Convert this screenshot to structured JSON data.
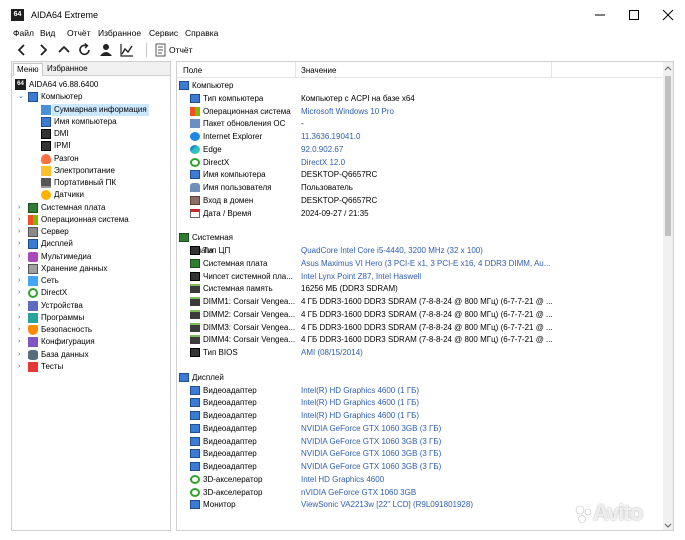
{
  "window": {
    "title": "AIDA64 Extreme",
    "icon_text": "64"
  },
  "menu": [
    "Файл",
    "Вид",
    "Отчёт",
    "Избранное",
    "Сервис",
    "Справка"
  ],
  "toolbar": {
    "report_label": "Отчёт"
  },
  "left_tabs": [
    "Меню",
    "Избранное"
  ],
  "tree": {
    "root_label": "AIDA64 v6.88.6400",
    "computer_label": "Компьютер",
    "computer_children": [
      {
        "label": "Суммарная информация",
        "icon": "info-icon"
      },
      {
        "label": "Имя компьютера",
        "icon": "computer-icon"
      },
      {
        "label": "DMI",
        "icon": "chip-icon"
      },
      {
        "label": "IPMI",
        "icon": "chip-icon"
      },
      {
        "label": "Разгон",
        "icon": "fire-icon"
      },
      {
        "label": "Электропитание",
        "icon": "power-icon"
      },
      {
        "label": "Портативный ПК",
        "icon": "laptop-icon"
      },
      {
        "label": "Датчики",
        "icon": "gauge-icon"
      }
    ],
    "top_items": [
      {
        "label": "Системная плата",
        "icon": "motherboard-icon"
      },
      {
        "label": "Операционная система",
        "icon": "windows-icon"
      },
      {
        "label": "Сервер",
        "icon": "server-icon"
      },
      {
        "label": "Дисплей",
        "icon": "monitor-icon"
      },
      {
        "label": "Мультимедиа",
        "icon": "multimedia-icon"
      },
      {
        "label": "Хранение данных",
        "icon": "storage-icon"
      },
      {
        "label": "Сеть",
        "icon": "network-icon"
      },
      {
        "label": "DirectX",
        "icon": "directx-icon"
      },
      {
        "label": "Устройства",
        "icon": "devices-icon"
      },
      {
        "label": "Программы",
        "icon": "programs-icon"
      },
      {
        "label": "Безопасность",
        "icon": "security-icon"
      },
      {
        "label": "Конфигурация",
        "icon": "config-icon"
      },
      {
        "label": "База данных",
        "icon": "database-icon"
      },
      {
        "label": "Тесты",
        "icon": "tests-icon"
      }
    ]
  },
  "columns": {
    "field": "Поле",
    "value": "Значение"
  },
  "sections": [
    {
      "title": "Компьютер",
      "icon": "computer-icon",
      "rows": [
        {
          "field": "Тип компьютера",
          "value": "Компьютер с ACPI на базе x64",
          "link": false,
          "icon": "computer-icon"
        },
        {
          "field": "Операционная система",
          "value": "Microsoft Windows 10 Pro",
          "link": true,
          "icon": "windows-icon"
        },
        {
          "field": "Пакет обновления ОС",
          "value": "-",
          "link": false,
          "icon": "package-icon"
        },
        {
          "field": "Internet Explorer",
          "value": "11.3636.19041.0",
          "link": true,
          "icon": "ie-icon"
        },
        {
          "field": "Edge",
          "value": "92.0.902.67",
          "link": true,
          "icon": "edge-icon"
        },
        {
          "field": "DirectX",
          "value": "DirectX 12.0",
          "link": true,
          "icon": "directx-icon"
        },
        {
          "field": "Имя компьютера",
          "value": "DESKTOP-Q6657RC",
          "link": false,
          "icon": "computer-icon"
        },
        {
          "field": "Имя пользователя",
          "value": "Пользователь",
          "link": false,
          "icon": "user-icon"
        },
        {
          "field": "Вход в домен",
          "value": "DESKTOP-Q6657RC",
          "link": false,
          "icon": "domain-icon"
        },
        {
          "field": "Дата / Время",
          "value": "2024-09-27 / 21:35",
          "link": false,
          "icon": "calendar-icon"
        }
      ]
    },
    {
      "title": "Системная плата",
      "icon": "motherboard-icon",
      "rows": [
        {
          "field": "Тип ЦП",
          "value": "QuadCore Intel Core i5-4440, 3200 MHz (32 x 100)",
          "link": true,
          "icon": "cpu-icon"
        },
        {
          "field": "Системная плата",
          "value": "Asus Maximus VI Hero  (3 PCI-E x1, 3 PCI-E x16, 4 DDR3 DIMM, Au...",
          "link": true,
          "icon": "motherboard-icon"
        },
        {
          "field": "Чипсет системной пла...",
          "value": "Intel Lynx Point Z87, Intel Haswell",
          "link": true,
          "icon": "chip-icon"
        },
        {
          "field": "Системная память",
          "value": "16256 МБ  (DDR3 SDRAM)",
          "link": false,
          "icon": "ram-icon"
        },
        {
          "field": "DIMM1: Corsair Vengea...",
          "value": "4 ГБ DDR3-1600 DDR3 SDRAM  (7-8-8-24 @ 800 МГц)  (6-7-7-21 @ ...",
          "link": false,
          "icon": "ram-icon"
        },
        {
          "field": "DIMM2: Corsair Vengea...",
          "value": "4 ГБ DDR3-1600 DDR3 SDRAM  (7-8-8-24 @ 800 МГц)  (6-7-7-21 @ ...",
          "link": false,
          "icon": "ram-icon"
        },
        {
          "field": "DIMM3: Corsair Vengea...",
          "value": "4 ГБ DDR3-1600 DDR3 SDRAM  (7-8-8-24 @ 800 МГц)  (6-7-7-21 @ ...",
          "link": false,
          "icon": "ram-icon"
        },
        {
          "field": "DIMM4: Corsair Vengea...",
          "value": "4 ГБ DDR3-1600 DDR3 SDRAM  (7-8-8-24 @ 800 МГц)  (6-7-7-21 @ ...",
          "link": false,
          "icon": "ram-icon"
        },
        {
          "field": "Тип BIOS",
          "value": "AMI (08/15/2014)",
          "link": true,
          "icon": "chip-icon"
        }
      ]
    },
    {
      "title": "Дисплей",
      "icon": "monitor-icon",
      "rows": [
        {
          "field": "Видеоадаптер",
          "value": "Intel(R) HD Graphics 4600  (1 ГБ)",
          "link": true,
          "icon": "monitor-icon"
        },
        {
          "field": "Видеоадаптер",
          "value": "Intel(R) HD Graphics 4600  (1 ГБ)",
          "link": true,
          "icon": "monitor-icon"
        },
        {
          "field": "Видеоадаптер",
          "value": "Intel(R) HD Graphics 4600  (1 ГБ)",
          "link": true,
          "icon": "monitor-icon"
        },
        {
          "field": "Видеоадаптер",
          "value": "NVIDIA GeForce GTX 1060 3GB  (3 ГБ)",
          "link": true,
          "icon": "monitor-icon"
        },
        {
          "field": "Видеоадаптер",
          "value": "NVIDIA GeForce GTX 1060 3GB  (3 ГБ)",
          "link": true,
          "icon": "monitor-icon"
        },
        {
          "field": "Видеоадаптер",
          "value": "NVIDIA GeForce GTX 1060 3GB  (3 ГБ)",
          "link": true,
          "icon": "monitor-icon"
        },
        {
          "field": "Видеоадаптер",
          "value": "NVIDIA GeForce GTX 1060 3GB  (3 ГБ)",
          "link": true,
          "icon": "monitor-icon"
        },
        {
          "field": "3D-акселератор",
          "value": "Intel HD Graphics 4600",
          "link": true,
          "icon": "directx-icon"
        },
        {
          "field": "3D-акселератор",
          "value": "nVIDIA GeForce GTX 1060 3GB",
          "link": true,
          "icon": "directx-icon"
        },
        {
          "field": "Монитор",
          "value": "ViewSonic VA2213w  [22\" LCD]  (R9L091801928)",
          "link": true,
          "icon": "monitor-icon"
        }
      ]
    }
  ],
  "watermark": "Avito",
  "colors": {
    "link": "#3060b0",
    "selection": "#cce8ff"
  }
}
